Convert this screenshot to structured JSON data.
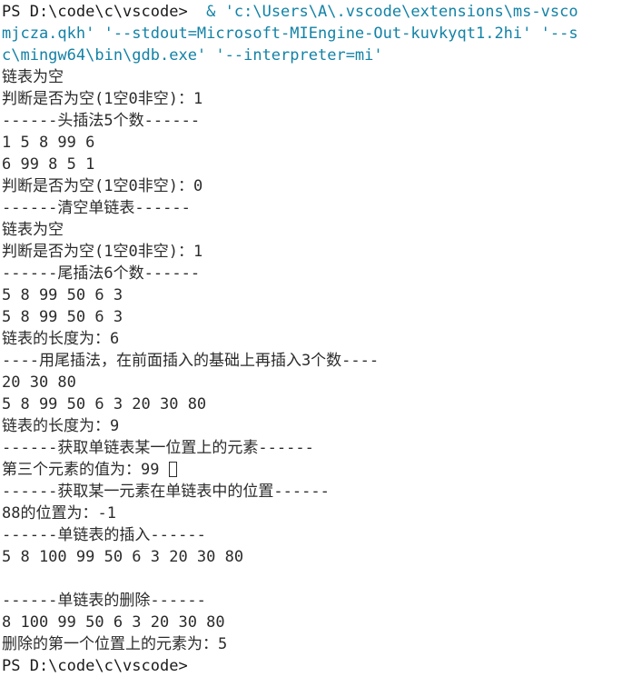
{
  "terminal": {
    "shell": "PowerShell",
    "prompt": "PS D:\\code\\c\\vscode>",
    "background_color": "#ffffff",
    "foreground_color": "#262626",
    "accent_color": "#1382a6",
    "font_size_px": 17,
    "line_height_px": 24,
    "cursor": {
      "style": "block-outline",
      "color": "#2b2b2b"
    },
    "lines": [
      {
        "id": "l1",
        "segments": [
          {
            "style": "prompt",
            "text": "PS D:\\code\\c\\vscode>"
          },
          {
            "style": "cmd",
            "text": "  & 'c:\\Users\\A\\.vscode\\extensions\\ms-vsco"
          }
        ]
      },
      {
        "id": "l2",
        "segments": [
          {
            "style": "cmd",
            "text": "mjcza.qkh' '--stdout=Microsoft-MIEngine-Out-kuvkyqt1.2hi' '--s"
          }
        ]
      },
      {
        "id": "l3",
        "segments": [
          {
            "style": "cmd",
            "text": "c\\mingw64\\bin\\gdb.exe' '--interpreter=mi'"
          }
        ]
      },
      {
        "id": "l4",
        "segments": [
          {
            "style": "out",
            "text": "链表为空"
          }
        ]
      },
      {
        "id": "l5",
        "segments": [
          {
            "style": "out",
            "text": "判断是否为空(1空0非空)：1"
          }
        ]
      },
      {
        "id": "l6",
        "segments": [
          {
            "style": "out",
            "text": "------头插法5个数------"
          }
        ]
      },
      {
        "id": "l7",
        "segments": [
          {
            "style": "out",
            "text": "1 5 8 99 6 "
          }
        ]
      },
      {
        "id": "l8",
        "segments": [
          {
            "style": "out",
            "text": "6 99 8 5 1 "
          }
        ]
      },
      {
        "id": "l9",
        "segments": [
          {
            "style": "out",
            "text": "判断是否为空(1空0非空)：0"
          }
        ]
      },
      {
        "id": "l10",
        "segments": [
          {
            "style": "out",
            "text": "------清空单链表------"
          }
        ]
      },
      {
        "id": "l11",
        "segments": [
          {
            "style": "out",
            "text": "链表为空"
          }
        ]
      },
      {
        "id": "l12",
        "segments": [
          {
            "style": "out",
            "text": "判断是否为空(1空0非空)：1"
          }
        ]
      },
      {
        "id": "l13",
        "segments": [
          {
            "style": "out",
            "text": "------尾插法6个数------"
          }
        ]
      },
      {
        "id": "l14",
        "segments": [
          {
            "style": "out",
            "text": "5 8 99 50 6 3 "
          }
        ]
      },
      {
        "id": "l15",
        "segments": [
          {
            "style": "out",
            "text": "5 8 99 50 6 3 "
          }
        ]
      },
      {
        "id": "l16",
        "segments": [
          {
            "style": "out",
            "text": "链表的长度为：6"
          }
        ]
      },
      {
        "id": "l17",
        "segments": [
          {
            "style": "out",
            "text": "----用尾插法，在前面插入的基础上再插入3个数----"
          }
        ]
      },
      {
        "id": "l18",
        "segments": [
          {
            "style": "out",
            "text": "20 30 80 "
          }
        ]
      },
      {
        "id": "l19",
        "segments": [
          {
            "style": "out",
            "text": "5 8 99 50 6 3 20 30 80 "
          }
        ]
      },
      {
        "id": "l20",
        "segments": [
          {
            "style": "out",
            "text": "链表的长度为：9"
          }
        ]
      },
      {
        "id": "l21",
        "segments": [
          {
            "style": "out",
            "text": "------获取单链表某一位置上的元素------"
          }
        ]
      },
      {
        "id": "l22",
        "segments": [
          {
            "style": "out",
            "text": "第三个元素的值为：99 "
          }
        ],
        "cursor_after": true
      },
      {
        "id": "l23",
        "segments": [
          {
            "style": "out",
            "text": "------获取某一元素在单链表中的位置------"
          }
        ]
      },
      {
        "id": "l24",
        "segments": [
          {
            "style": "out",
            "text": "88的位置为：-1"
          }
        ]
      },
      {
        "id": "l25",
        "segments": [
          {
            "style": "out",
            "text": "------单链表的插入------"
          }
        ]
      },
      {
        "id": "l26",
        "segments": [
          {
            "style": "out",
            "text": "5 8 100 99 50 6 3 20 30 80 "
          }
        ]
      },
      {
        "id": "l27",
        "segments": [
          {
            "style": "out",
            "text": ""
          }
        ]
      },
      {
        "id": "l28",
        "segments": [
          {
            "style": "out",
            "text": "------单链表的删除------"
          }
        ]
      },
      {
        "id": "l29",
        "segments": [
          {
            "style": "out",
            "text": "8 100 99 50 6 3 20 30 80 "
          }
        ]
      },
      {
        "id": "l30",
        "segments": [
          {
            "style": "out",
            "text": "删除的第一个位置上的元素为：5"
          }
        ]
      },
      {
        "id": "l31",
        "segments": [
          {
            "style": "prompt",
            "text": "PS D:\\code\\c\\vscode>"
          }
        ]
      }
    ]
  }
}
